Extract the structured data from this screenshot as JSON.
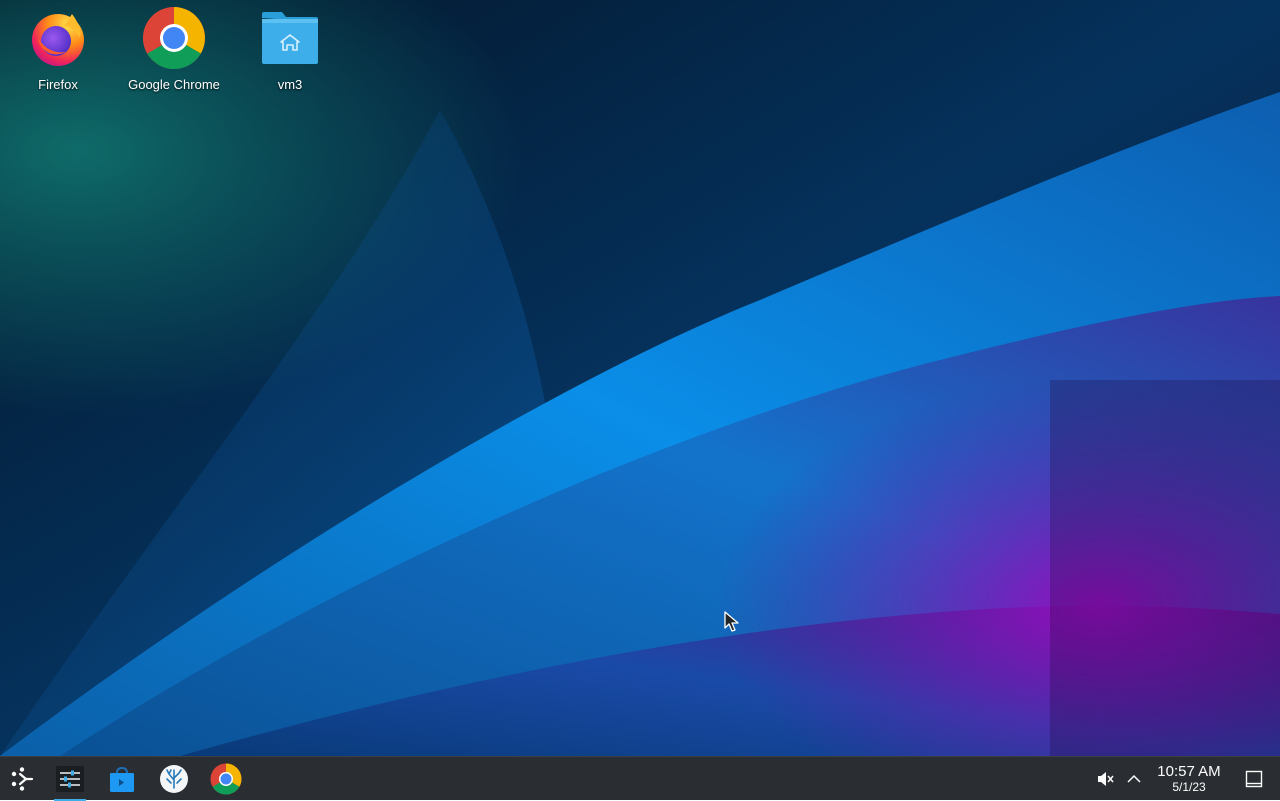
{
  "desktop": {
    "icons": [
      {
        "label": "Firefox",
        "icon": "firefox-icon"
      },
      {
        "label": "Google Chrome",
        "icon": "chrome-icon"
      },
      {
        "label": "vm3",
        "icon": "home-folder-icon"
      }
    ]
  },
  "taskbar": {
    "launcher_icon": "application-launcher-icon",
    "tasks": [
      {
        "icon": "system-settings-icon",
        "active": true
      },
      {
        "icon": "discover-store-icon",
        "active": false
      },
      {
        "icon": "coral-app-icon",
        "active": false
      },
      {
        "icon": "chrome-icon",
        "active": false
      }
    ],
    "tray": {
      "volume_icon": "volume-muted-icon",
      "expand_icon": "chevron-up-icon",
      "show_desktop_icon": "show-desktop-icon"
    },
    "clock": {
      "time": "10:57 AM",
      "date": "5/1/23"
    }
  },
  "colors": {
    "taskbar_bg": "#2a2e32",
    "accent": "#3daee9",
    "wallpaper_blue": "#0a8ae6",
    "wallpaper_purple": "#8a10b8",
    "wallpaper_teal": "#0e6e6a"
  }
}
